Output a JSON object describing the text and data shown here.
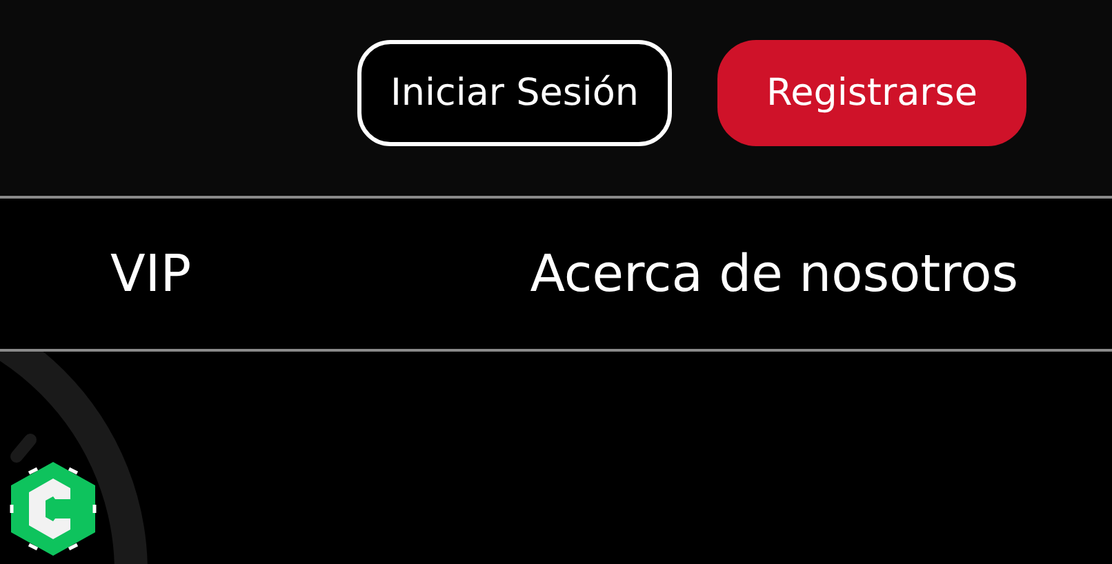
{
  "header": {
    "buttons": [
      {
        "label": "Iniciar Sesión",
        "kind": "outline"
      },
      {
        "label": "Registrarse",
        "kind": "filled"
      }
    ]
  },
  "nav": {
    "items": [
      {
        "label": "VIP"
      },
      {
        "label": "Acerca de nosotros"
      }
    ]
  }
}
